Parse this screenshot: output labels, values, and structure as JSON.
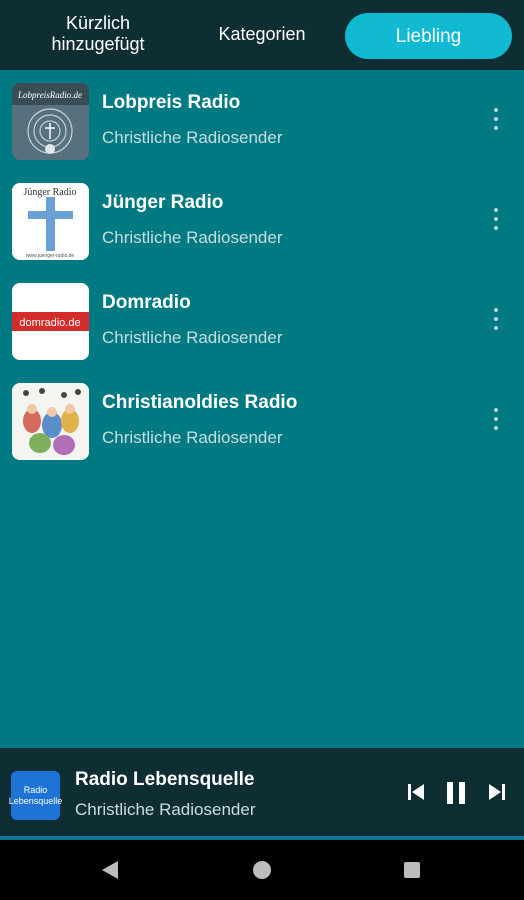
{
  "tabs": {
    "recent": "Kürzlich\nhinzugefügt",
    "categories": "Kategorien",
    "favorites": "Liebling"
  },
  "stations": [
    {
      "name": "Lobpreis Radio",
      "genre": "Christliche Radiosender",
      "logo_text": "LobpreisRadio.de"
    },
    {
      "name": "Jünger Radio",
      "genre": "Christliche Radiosender",
      "logo_text": "Jünger Radio",
      "logo_url_text": "www.juenger-radio.de"
    },
    {
      "name": "Domradio",
      "genre": "Christliche Radiosender",
      "logo_text": "domradio.de"
    },
    {
      "name": "Christianoldies Radio",
      "genre": "Christliche Radiosender",
      "logo_text": ""
    }
  ],
  "player": {
    "title": "Radio Lebensquelle",
    "subtitle": "Christliche Radiosender",
    "logo_text": "Radio Lebensquelle",
    "state": "playing"
  },
  "colors": {
    "background": "#007a82",
    "topbar": "#0e2e33",
    "accent": "#11b9d3",
    "player_logo": "#1d74d6"
  },
  "icons": {
    "previous": "skip-previous-icon",
    "pause": "pause-icon",
    "next": "skip-next-icon",
    "more": "more-vert-icon",
    "back": "nav-back-icon",
    "home": "nav-home-icon",
    "recents": "nav-recents-icon"
  }
}
